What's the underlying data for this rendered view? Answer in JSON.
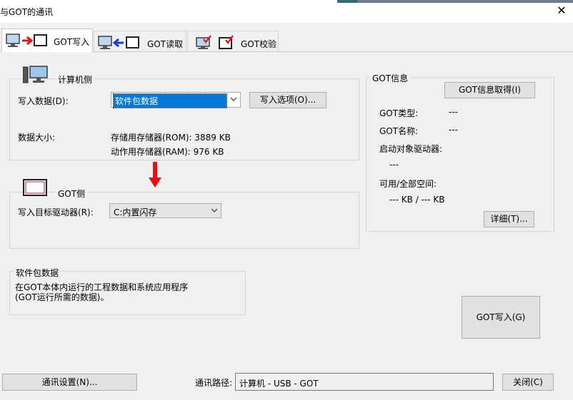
{
  "window": {
    "title": "与GOT的通讯",
    "close_glyph": "✕"
  },
  "tabs": [
    {
      "label": "GOT写入",
      "icon": "pc-to-got-icon"
    },
    {
      "label": "GOT读取",
      "icon": "got-to-pc-icon"
    },
    {
      "label": "GOT校验",
      "icon": "verify-icon"
    }
  ],
  "pc_side": {
    "title": "计算机侧",
    "write_data_label": "写入数据(D):",
    "write_data_value": "软件包数据",
    "write_options_button": "写入选项(O)...",
    "data_size_label": "数据大小:",
    "rom_text": "存储用存储器(ROM): 3889 KB",
    "ram_text": "动作用存储器(RAM): 976 KB"
  },
  "got_side": {
    "title": "GOT侧",
    "target_drive_label": "写入目标驱动器(R):",
    "target_drive_value": "C:内置闪存"
  },
  "got_info": {
    "title": "GOT信息",
    "get_button": "GOT信息取得(I)",
    "type_label": "GOT类型:",
    "type_value": "---",
    "name_label": "GOT名称:",
    "name_value": "---",
    "boot_drive_label": "启动对象驱动器:",
    "boot_drive_value": "---",
    "space_label": "可用/全部空间:",
    "space_value": "--- KB / --- KB",
    "detail_button": "详细(T)..."
  },
  "package_info": {
    "title": "软件包数据",
    "line1": "在GOT本体内运行的工程数据和系统应用程序",
    "line2": "(GOT运行所需的数据)。"
  },
  "got_write_button": "GOT写入(G)",
  "footer": {
    "comm_settings_button": "通讯设置(N)...",
    "route_label": "通讯路径:",
    "route_value": "计算机 - USB - GOT",
    "close_button": "关闭(C)"
  },
  "colors": {
    "accent": "#0078d7",
    "arrow_red": "#e81010",
    "arrow_blue": "#1a3fd6"
  }
}
